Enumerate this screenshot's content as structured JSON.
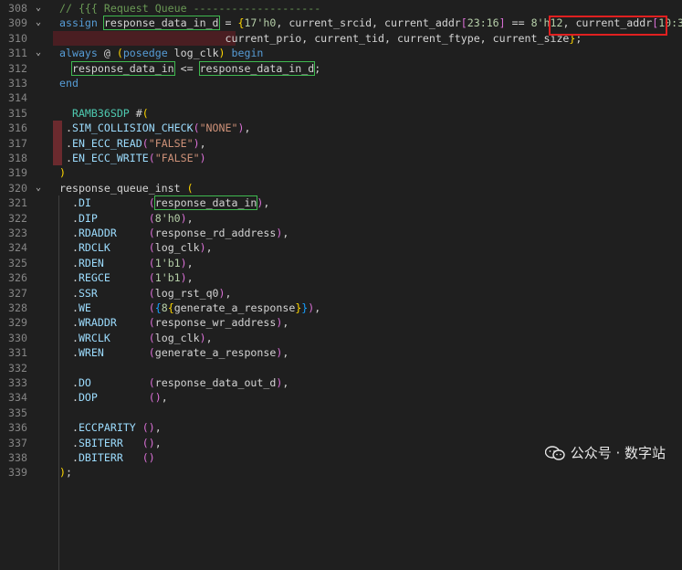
{
  "lines": [
    {
      "n": "308",
      "fold": true,
      "segs": [
        [
          "cm",
          "// {{{ Request Queue --------------------"
        ]
      ]
    },
    {
      "n": "309",
      "fold": true,
      "segs": [
        [
          "kw",
          "assign "
        ],
        [
          "id",
          "response_data_in_d",
          "hl"
        ],
        [
          "id",
          " = "
        ],
        [
          "br1",
          "{"
        ],
        [
          "num",
          "17'h0"
        ],
        [
          "id",
          ", current_srcid, current_addr"
        ],
        [
          "br2",
          "["
        ],
        [
          "num",
          "23:16"
        ],
        [
          "br2",
          "]"
        ],
        [
          "id",
          " == "
        ],
        [
          "num",
          "8'h12"
        ],
        [
          "id",
          ", "
        ],
        [
          "id",
          "current_addr"
        ],
        [
          "br2",
          "["
        ],
        [
          "num",
          "10:3"
        ],
        [
          "br2",
          "]"
        ],
        [
          "id",
          ","
        ]
      ]
    },
    {
      "n": "310",
      "fold": false,
      "segs": [
        [
          "id",
          "                          current_prio, current_tid, current_ftype, current_size"
        ],
        [
          "br1",
          "}"
        ],
        [
          "id",
          ";"
        ]
      ]
    },
    {
      "n": "311",
      "fold": true,
      "segs": [
        [
          "kw",
          "always"
        ],
        [
          "id",
          " @ "
        ],
        [
          "br1",
          "("
        ],
        [
          "kw",
          "posedge"
        ],
        [
          "id",
          " log_clk"
        ],
        [
          "br1",
          ")"
        ],
        [
          "kw",
          " begin"
        ]
      ]
    },
    {
      "n": "312",
      "fold": false,
      "segs": [
        [
          "id",
          "  "
        ],
        [
          "id",
          "response_data_in",
          "hl"
        ],
        [
          "id",
          " <= "
        ],
        [
          "id",
          "response_data_in_d",
          "hl"
        ],
        [
          "id",
          ";"
        ]
      ]
    },
    {
      "n": "313",
      "fold": false,
      "segs": [
        [
          "kw",
          "end"
        ]
      ]
    },
    {
      "n": "314",
      "fold": false,
      "segs": []
    },
    {
      "n": "315",
      "fold": false,
      "segs": [
        [
          "id",
          "  "
        ],
        [
          "ty",
          "RAMB36SDP"
        ],
        [
          "id",
          " #"
        ],
        [
          "br1",
          "("
        ]
      ]
    },
    {
      "n": "316",
      "fold": false,
      "segs": [
        [
          "id",
          " ."
        ],
        [
          "prop",
          "SIM_COLLISION_CHECK"
        ],
        [
          "br2",
          "("
        ],
        [
          "str",
          "\"NONE\""
        ],
        [
          "br2",
          ")"
        ],
        [
          "id",
          ","
        ]
      ]
    },
    {
      "n": "317",
      "fold": false,
      "segs": [
        [
          "id",
          " ."
        ],
        [
          "prop",
          "EN_ECC_READ"
        ],
        [
          "br2",
          "("
        ],
        [
          "str",
          "\"FALSE\""
        ],
        [
          "br2",
          ")"
        ],
        [
          "id",
          ","
        ]
      ]
    },
    {
      "n": "318",
      "fold": false,
      "segs": [
        [
          "id",
          " ."
        ],
        [
          "prop",
          "EN_ECC_WRITE"
        ],
        [
          "br2",
          "("
        ],
        [
          "str",
          "\"FALSE\""
        ],
        [
          "br2",
          ")"
        ]
      ]
    },
    {
      "n": "319",
      "fold": false,
      "segs": [
        [
          "br1",
          ")"
        ]
      ]
    },
    {
      "n": "320",
      "fold": true,
      "segs": [
        [
          "id",
          "response_queue_inst "
        ],
        [
          "br1",
          "("
        ]
      ]
    },
    {
      "n": "321",
      "fold": false,
      "segs": [
        [
          "id",
          "  ."
        ],
        [
          "prop",
          "DI"
        ],
        [
          "id",
          "         "
        ],
        [
          "br2",
          "("
        ],
        [
          "id",
          "response_data_in",
          "hl"
        ],
        [
          "br2",
          ")"
        ],
        [
          "id",
          ","
        ]
      ]
    },
    {
      "n": "322",
      "fold": false,
      "segs": [
        [
          "id",
          "  ."
        ],
        [
          "prop",
          "DIP"
        ],
        [
          "id",
          "        "
        ],
        [
          "br2",
          "("
        ],
        [
          "num",
          "8'h0"
        ],
        [
          "br2",
          ")"
        ],
        [
          "id",
          ","
        ]
      ]
    },
    {
      "n": "323",
      "fold": false,
      "segs": [
        [
          "id",
          "  ."
        ],
        [
          "prop",
          "RDADDR"
        ],
        [
          "id",
          "     "
        ],
        [
          "br2",
          "("
        ],
        [
          "id",
          "response_rd_address"
        ],
        [
          "br2",
          ")"
        ],
        [
          "id",
          ","
        ]
      ]
    },
    {
      "n": "324",
      "fold": false,
      "segs": [
        [
          "id",
          "  ."
        ],
        [
          "prop",
          "RDCLK"
        ],
        [
          "id",
          "      "
        ],
        [
          "br2",
          "("
        ],
        [
          "id",
          "log_clk"
        ],
        [
          "br2",
          ")"
        ],
        [
          "id",
          ","
        ]
      ]
    },
    {
      "n": "325",
      "fold": false,
      "segs": [
        [
          "id",
          "  ."
        ],
        [
          "prop",
          "RDEN"
        ],
        [
          "id",
          "       "
        ],
        [
          "br2",
          "("
        ],
        [
          "num",
          "1'b1"
        ],
        [
          "br2",
          ")"
        ],
        [
          "id",
          ","
        ]
      ]
    },
    {
      "n": "326",
      "fold": false,
      "segs": [
        [
          "id",
          "  ."
        ],
        [
          "prop",
          "REGCE"
        ],
        [
          "id",
          "      "
        ],
        [
          "br2",
          "("
        ],
        [
          "num",
          "1'b1"
        ],
        [
          "br2",
          ")"
        ],
        [
          "id",
          ","
        ]
      ]
    },
    {
      "n": "327",
      "fold": false,
      "segs": [
        [
          "id",
          "  ."
        ],
        [
          "prop",
          "SSR"
        ],
        [
          "id",
          "        "
        ],
        [
          "br2",
          "("
        ],
        [
          "id",
          "log_rst_q0"
        ],
        [
          "br2",
          ")"
        ],
        [
          "id",
          ","
        ]
      ]
    },
    {
      "n": "328",
      "fold": false,
      "segs": [
        [
          "id",
          "  ."
        ],
        [
          "prop",
          "WE"
        ],
        [
          "id",
          "         "
        ],
        [
          "br2",
          "("
        ],
        [
          "br3",
          "{"
        ],
        [
          "num",
          "8"
        ],
        [
          "br1",
          "{"
        ],
        [
          "id",
          "generate_a_response"
        ],
        [
          "br1",
          "}"
        ],
        [
          "br3",
          "}"
        ],
        [
          "br2",
          ")"
        ],
        [
          "id",
          ","
        ]
      ]
    },
    {
      "n": "329",
      "fold": false,
      "segs": [
        [
          "id",
          "  ."
        ],
        [
          "prop",
          "WRADDR"
        ],
        [
          "id",
          "     "
        ],
        [
          "br2",
          "("
        ],
        [
          "id",
          "response_wr_address"
        ],
        [
          "br2",
          ")"
        ],
        [
          "id",
          ","
        ]
      ]
    },
    {
      "n": "330",
      "fold": false,
      "segs": [
        [
          "id",
          "  ."
        ],
        [
          "prop",
          "WRCLK"
        ],
        [
          "id",
          "      "
        ],
        [
          "br2",
          "("
        ],
        [
          "id",
          "log_clk"
        ],
        [
          "br2",
          ")"
        ],
        [
          "id",
          ","
        ]
      ]
    },
    {
      "n": "331",
      "fold": false,
      "segs": [
        [
          "id",
          "  ."
        ],
        [
          "prop",
          "WREN"
        ],
        [
          "id",
          "       "
        ],
        [
          "br2",
          "("
        ],
        [
          "id",
          "generate_a_response"
        ],
        [
          "br2",
          ")"
        ],
        [
          "id",
          ","
        ]
      ]
    },
    {
      "n": "332",
      "fold": false,
      "segs": []
    },
    {
      "n": "333",
      "fold": false,
      "segs": [
        [
          "id",
          "  ."
        ],
        [
          "prop",
          "DO"
        ],
        [
          "id",
          "         "
        ],
        [
          "br2",
          "("
        ],
        [
          "id",
          "response_data_out_d"
        ],
        [
          "br2",
          ")"
        ],
        [
          "id",
          ","
        ]
      ]
    },
    {
      "n": "334",
      "fold": false,
      "segs": [
        [
          "id",
          "  ."
        ],
        [
          "prop",
          "DOP"
        ],
        [
          "id",
          "        "
        ],
        [
          "br2",
          "("
        ],
        [
          "br2",
          ")"
        ],
        [
          "id",
          ","
        ]
      ]
    },
    {
      "n": "335",
      "fold": false,
      "segs": []
    },
    {
      "n": "336",
      "fold": false,
      "segs": [
        [
          "id",
          "  ."
        ],
        [
          "prop",
          "ECCPARITY"
        ],
        [
          "id",
          " "
        ],
        [
          "br2",
          "("
        ],
        [
          "br2",
          ")"
        ],
        [
          "id",
          ","
        ]
      ]
    },
    {
      "n": "337",
      "fold": false,
      "segs": [
        [
          "id",
          "  ."
        ],
        [
          "prop",
          "SBITERR"
        ],
        [
          "id",
          "   "
        ],
        [
          "br2",
          "("
        ],
        [
          "br2",
          ")"
        ],
        [
          "id",
          ","
        ]
      ]
    },
    {
      "n": "338",
      "fold": false,
      "segs": [
        [
          "id",
          "  ."
        ],
        [
          "prop",
          "DBITERR"
        ],
        [
          "id",
          "   "
        ],
        [
          "br2",
          "("
        ],
        [
          "br2",
          ")"
        ]
      ]
    },
    {
      "n": "339",
      "fold": false,
      "segs": [
        [
          "br1",
          ")"
        ],
        [
          "id",
          ";"
        ]
      ]
    }
  ],
  "watermark": {
    "label": "公众号 · 数字站"
  },
  "colors": {
    "background": "#1f1f1f",
    "keyword": "#569cd6",
    "comment": "#6a9955",
    "number": "#b5cea8",
    "string": "#ce9178",
    "highlight_box": "#e02020"
  }
}
